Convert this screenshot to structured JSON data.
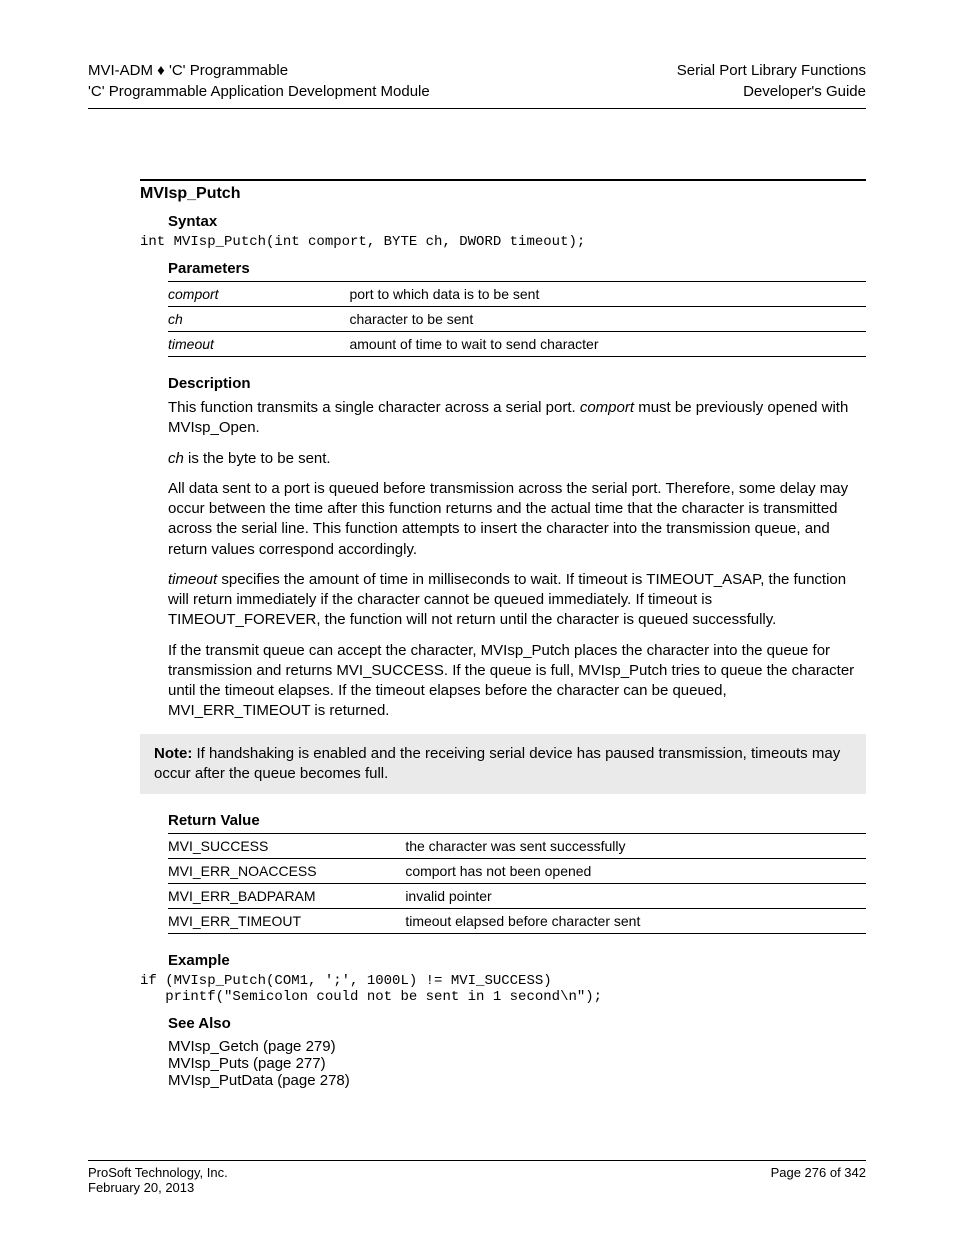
{
  "header": {
    "left_line1": "MVI-ADM ♦ 'C' Programmable",
    "left_line2": "'C' Programmable Application Development Module",
    "right_line1": "Serial Port Library Functions",
    "right_line2": "Developer's Guide"
  },
  "function_title": "MVIsp_Putch",
  "syntax": {
    "heading": "Syntax",
    "code": "int MVIsp_Putch(int comport, BYTE ch, DWORD timeout);"
  },
  "parameters": {
    "heading": "Parameters",
    "rows": [
      {
        "name": "comport",
        "desc": "port to which data is to be sent"
      },
      {
        "name": "ch",
        "desc": "character to be sent"
      },
      {
        "name": "timeout",
        "desc": "amount of time to wait to send character"
      }
    ]
  },
  "description": {
    "heading": "Description",
    "p1a": "This function transmits a single character across a serial port. ",
    "p1b_ital": "comport",
    "p1c": " must be previously opened with MVIsp_Open.",
    "p2_ital": "ch",
    "p2": " is the byte to be sent.",
    "p3": "All data sent to a port is queued before transmission across the serial port. Therefore, some delay may occur between the time after this function returns and the actual time that the character is transmitted across the serial line. This function attempts to insert the character into the transmission queue, and return values correspond accordingly.",
    "p4_ital": "timeout",
    "p4": " specifies the amount of time in milliseconds to wait. If timeout is TIMEOUT_ASAP, the function will return immediately if the character cannot be queued immediately. If timeout is TIMEOUT_FOREVER, the function will not return until the character is queued successfully.",
    "p5a": "If the transmit queue can accept the character, MVIsp_Putch places the character into the queue for transmission and returns MVI_SUCCESS. If the queue is full, MVIsp_Putch tries to queue the character until the timeout elapses. If the timeout elapses before the character can be queued, MVI_ERR_TIMEOUT is returned."
  },
  "note": {
    "label": "Note:",
    "text": " If handshaking is enabled and the receiving serial device has paused transmission, timeouts may occur after the queue becomes full."
  },
  "return_value": {
    "heading": "Return Value",
    "rows": [
      {
        "name": "MVI_SUCCESS",
        "desc": "the character was sent successfully"
      },
      {
        "name": "MVI_ERR_NOACCESS",
        "desc": "comport has not been opened"
      },
      {
        "name": "MVI_ERR_BADPARAM",
        "desc": "invalid pointer"
      },
      {
        "name": "MVI_ERR_TIMEOUT",
        "desc": "timeout elapsed before character sent"
      }
    ]
  },
  "example": {
    "heading": "Example",
    "code": "if (MVIsp_Putch(COM1, ';', 1000L) != MVI_SUCCESS)\n   printf(\"Semicolon could not be sent in 1 second\\n\");"
  },
  "see_also": {
    "heading": "See Also",
    "links": "MVIsp_Getch (page 279)\nMVIsp_Puts (page 277)\nMVIsp_PutData (page 278)"
  },
  "footer": {
    "left_line1": "ProSoft Technology, Inc.",
    "left_line2": "February 20, 2013",
    "center": "",
    "right": "Page 276 of 342"
  }
}
